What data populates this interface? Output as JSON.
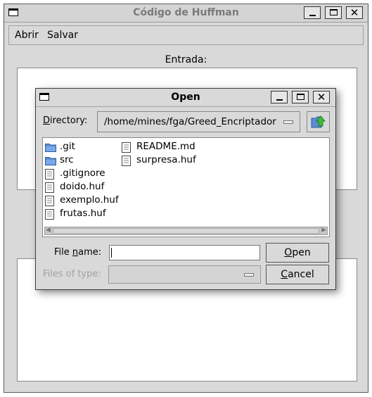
{
  "main_window": {
    "title": "Código de Huffman",
    "menu": [
      "Abrir",
      "Salvar"
    ],
    "entrada_label": "Entrada:"
  },
  "dialog": {
    "title": "Open",
    "directory_label_underlined": "D",
    "directory_label_rest": "irectory:",
    "directory_value": "/home/mines/fga/Greed_Encriptador",
    "files_col1": [
      {
        "name": ".git",
        "icon": "folder-icon"
      },
      {
        "name": "src",
        "icon": "folder-icon"
      },
      {
        "name": ".gitignore",
        "icon": "file-icon"
      },
      {
        "name": "doido.huf",
        "icon": "file-icon"
      },
      {
        "name": "exemplo.huf",
        "icon": "file-icon"
      },
      {
        "name": "frutas.huf",
        "icon": "file-icon"
      }
    ],
    "files_col2": [
      {
        "name": "README.md",
        "icon": "file-icon"
      },
      {
        "name": "surpresa.huf",
        "icon": "file-icon"
      }
    ],
    "file_name_label_pre": "File ",
    "file_name_label_underlined": "n",
    "file_name_label_post": "ame:",
    "file_name_value": "",
    "files_of_type_label": "Files of type:",
    "files_of_type_value": "",
    "open_underlined": "O",
    "open_rest": "pen",
    "cancel_underlined": "C",
    "cancel_rest": "ancel"
  },
  "colors": {
    "window_bg": "#d9d9d9",
    "disabled_text": "#a0a0a0",
    "folder_blue": "#5b8ed6",
    "up_arrow_green": "#3cbf3c"
  }
}
